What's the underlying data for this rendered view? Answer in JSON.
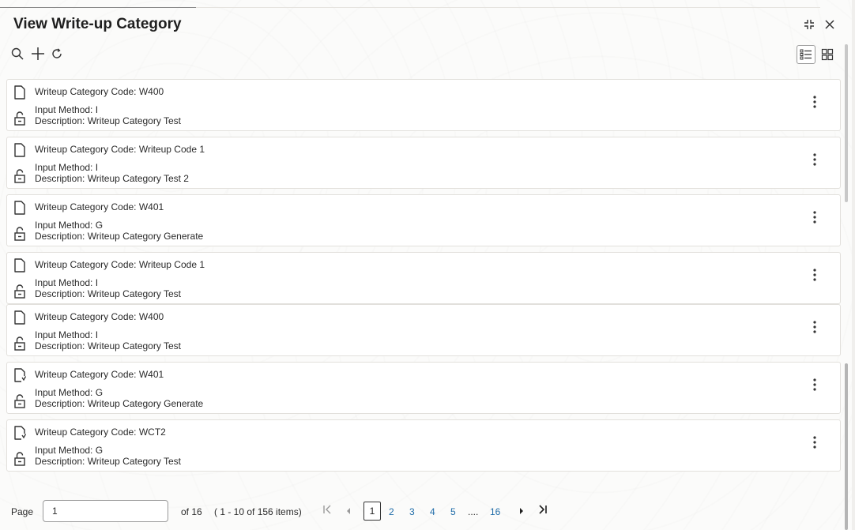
{
  "window": {
    "title": "View Write-up Category"
  },
  "toolbar": {
    "icons": [
      "search-icon",
      "add-icon",
      "refresh-icon"
    ],
    "view_modes": [
      "list-view-icon",
      "grid-view-icon"
    ]
  },
  "records": [
    {
      "code": "Writeup Category Code: W400",
      "input_method": "Input Method: I",
      "description": "Description: Writeup Category Test",
      "doc_icon": "document-icon"
    },
    {
      "code": "Writeup Category Code: Writeup Code 1",
      "input_method": "Input Method: I",
      "description": "Description: Writeup Category Test 2",
      "doc_icon": "document-icon"
    },
    {
      "code": "Writeup Category Code: W401",
      "input_method": "Input Method: G",
      "description": "Description: Writeup Category Generate",
      "doc_icon": "document-icon"
    },
    {
      "code": "Writeup Category Code: Writeup Code 1",
      "input_method": "Input Method: I",
      "description": "Description: Writeup Category Test",
      "doc_icon": "document-icon"
    },
    {
      "code": "Writeup Category Code: W400",
      "input_method": "Input Method: I",
      "description": "Description: Writeup Category Test",
      "doc_icon": "document-icon"
    },
    {
      "code": "Writeup Category Code: W401",
      "input_method": "Input Method: G",
      "description": "Description: Writeup Category Generate",
      "doc_icon": "document-modified-icon"
    },
    {
      "code": "Writeup Category Code: WCT2",
      "input_method": "Input Method: G",
      "description": "Description: Writeup Category Test",
      "doc_icon": "document-modified-icon"
    }
  ],
  "pagination": {
    "page_label": "Page",
    "current_page": "1",
    "of_text": "of 16",
    "range_text": "( 1 - 10 of 156 items)",
    "pages": [
      "1",
      "2",
      "3",
      "4",
      "5"
    ],
    "ellipsis": "....",
    "last_page": "16"
  },
  "colors": {
    "link": "#1f6ca8",
    "text": "#1f1f1f",
    "card_border": "#e2e0dc"
  }
}
